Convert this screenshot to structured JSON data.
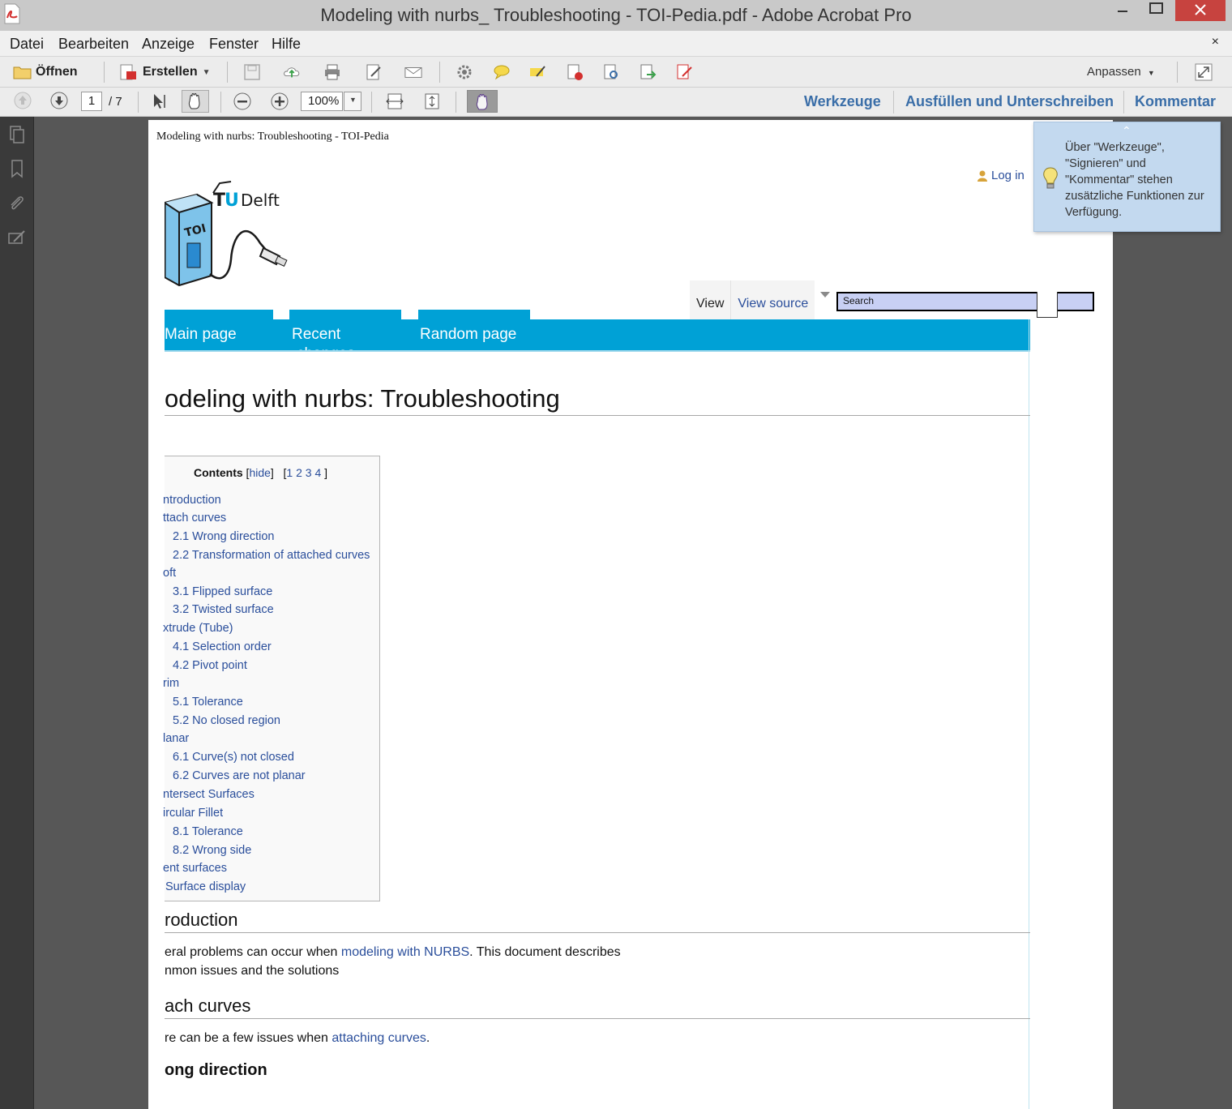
{
  "window": {
    "title": "Modeling with nurbs_ Troubleshooting - TOI-Pedia.pdf - Adobe Acrobat Pro"
  },
  "menu": {
    "items": [
      "Datei",
      "Bearbeiten",
      "Anzeige",
      "Fenster",
      "Hilfe"
    ],
    "close": "×"
  },
  "toolbar": {
    "open_label": "Öffnen",
    "create_label": "Erstellen",
    "customize_label": "Anpassen"
  },
  "navigation": {
    "current_page": "1",
    "total_pages": "/ 7",
    "zoom": "100%"
  },
  "panels": {
    "tools": "Werkzeuge",
    "fill_sign": "Ausfüllen und Unterschreiben",
    "comment": "Kommentar"
  },
  "tooltip": {
    "caret": "⌃",
    "text": "Über \"Werkzeuge\",\n\"Signieren\" und\n\"Kommentar\" stehen\nzusätzliche Funktionen zur\nVerfügung."
  },
  "document": {
    "header": "Modeling with nurbs: Troubleshooting - TOI-Pedia",
    "login": "Log in",
    "logo_text": "TUDelft",
    "tab_view": "View",
    "tab_source": "View source",
    "search_placeholder": "Search",
    "nav": {
      "main": "Main page",
      "recent": "Recent",
      "recent2": "changes",
      "random": "Random page"
    },
    "title": "odeling with nurbs: Troubleshooting",
    "toc": {
      "heading": "Contents",
      "hide": "hide",
      "pages": [
        "1",
        "2",
        "3",
        "4"
      ],
      "items": [
        "ntroduction",
        "ttach curves",
        "2.1 Wrong direction",
        "2.2 Transformation of attached curves",
        "oft",
        "3.1 Flipped surface",
        "3.2 Twisted surface",
        "xtrude (Tube)",
        "4.1 Selection order",
        "4.2 Pivot point",
        "rim",
        "5.1 Tolerance",
        "5.2 No closed region",
        "lanar",
        "6.1 Curve(s) not closed",
        "6.2 Curves are not planar",
        "ntersect Surfaces",
        "ircular Fillet",
        "8.1 Tolerance",
        "8.2 Wrong side",
        "ent surfaces",
        "Surface display"
      ]
    },
    "section1": {
      "heading": "roduction",
      "line1_pre": "eral problems can occur when ",
      "line1_link": "modeling with NURBS",
      "line1_post": ". This document describes",
      "line2": "nmon issues and the solutions"
    },
    "section2": {
      "heading": "ach curves",
      "line_pre": "re can be a few issues when ",
      "line_link": "attaching curves",
      "line_post": "."
    },
    "section3": {
      "heading": "ong direction"
    }
  }
}
